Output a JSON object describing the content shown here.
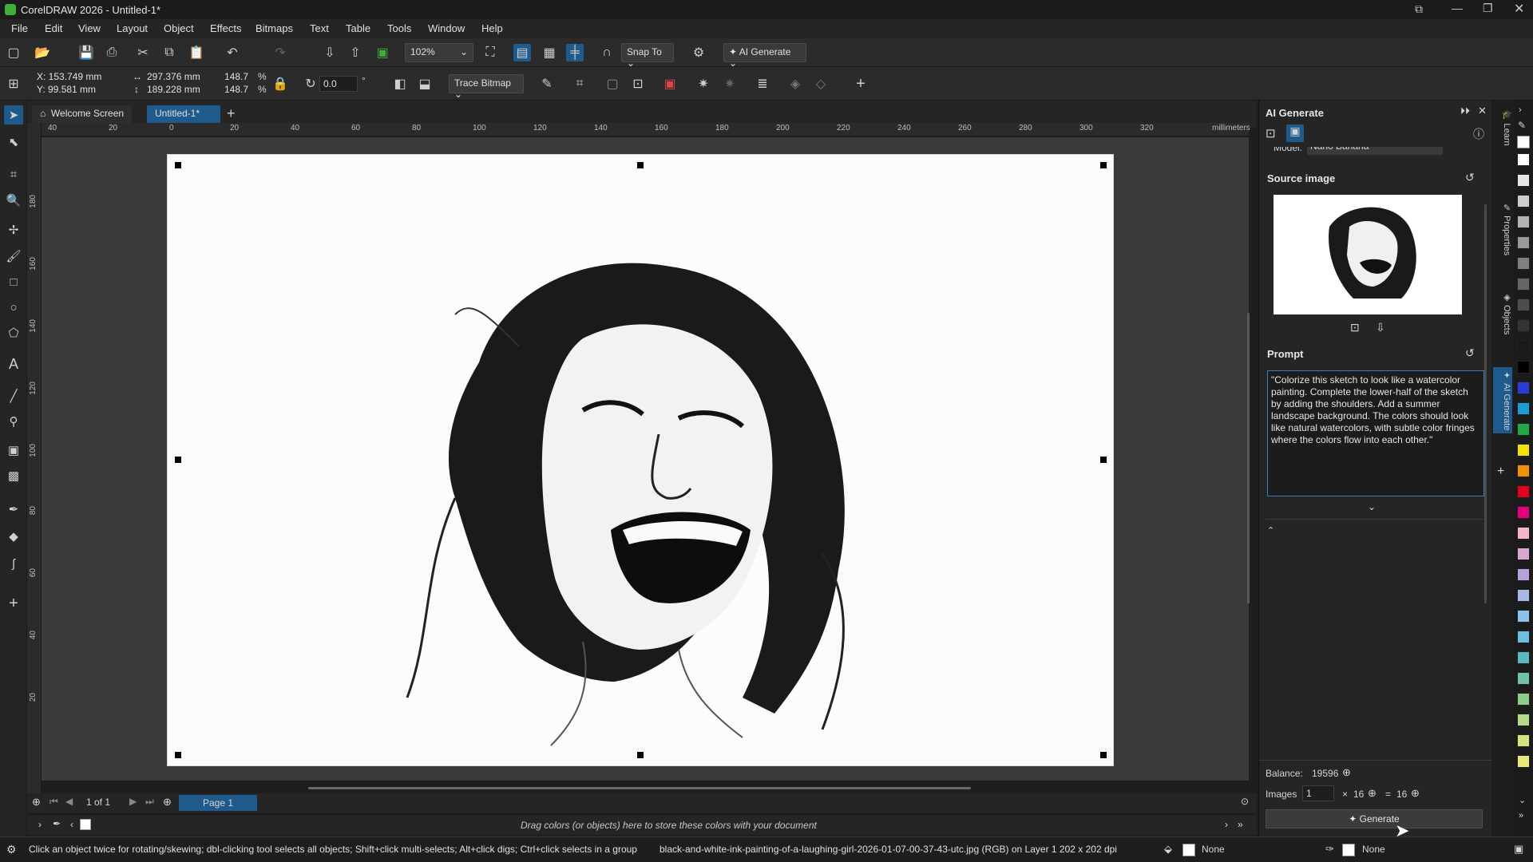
{
  "app": {
    "title": "CorelDRAW 2026 - Untitled-1*"
  },
  "menu": [
    "File",
    "Edit",
    "View",
    "Layout",
    "Object",
    "Effects",
    "Bitmaps",
    "Text",
    "Table",
    "Tools",
    "Window",
    "Help"
  ],
  "toolbar": {
    "zoom": "102%",
    "snap_to": "Snap To",
    "ai_generate": "AI Generate"
  },
  "properties": {
    "x": "X: 153.749 mm",
    "y": "Y: 99.581 mm",
    "width": "297.376 mm",
    "height": "189.228 mm",
    "scale_w": "148.7",
    "scale_h": "148.7",
    "pct": "%",
    "rotation": "0.0",
    "deg": "°",
    "trace_bitmap": "Trace Bitmap"
  },
  "tabs": {
    "welcome": "Welcome Screen",
    "doc": "Untitled-1*"
  },
  "ruler": {
    "unit": "millimeters",
    "h_ticks": [
      "40",
      "20",
      "0",
      "20",
      "40",
      "60",
      "80",
      "100",
      "120",
      "140",
      "160",
      "180",
      "200",
      "220",
      "240",
      "260",
      "280",
      "300",
      "320"
    ],
    "v_ticks": [
      "180",
      "160",
      "140",
      "120",
      "100",
      "80",
      "60",
      "40",
      "20"
    ]
  },
  "pager": {
    "count": "1 of 1",
    "page_tab": "Page 1"
  },
  "palette": {
    "hint": "Drag colors (or objects) here to store these colors with your document"
  },
  "status": {
    "hint": "Click an object twice for rotating/skewing; dbl-clicking tool selects all objects; Shift+click multi-selects; Alt+click digs; Ctrl+click selects in a group",
    "file": "black-and-white-ink-painting-of-a-laughing-girl-2026-01-07-00-37-43-utc.jpg (RGB) on Layer 1  202 x 202 dpi",
    "fill": "None",
    "outline": "None"
  },
  "docker": {
    "title": "AI Generate",
    "model_label": "Model:",
    "model_value": "Nano Banana",
    "source_image": "Source image",
    "prompt_label": "Prompt",
    "prompt_text": "\"Colorize this sketch to look like a watercolor painting. Complete the lower-half of the sketch by adding the shoulders. Add a summer landscape background. The colors should look like natural  watercolors, with subtle color fringes where the colors flow into each other.\"",
    "balance_label": "Balance:",
    "balance_value": "19596",
    "images_label": "Images",
    "images_value": "1",
    "times": "×",
    "per": "16",
    "equals": "=",
    "total": "16",
    "generate": "Generate"
  },
  "docker_tabs": [
    "Learn",
    "Properties",
    "Objects",
    "AI Generate"
  ],
  "colors": {
    "accent": "#1e5a8c",
    "bg": "#252526"
  },
  "palette_swatches": [
    "#ffffff",
    "#e6e6e6",
    "#cccccc",
    "#b3b3b3",
    "#999999",
    "#808080",
    "#666666",
    "#4d4d4d",
    "#333333",
    "#1a1a1a",
    "#000000",
    "#2b3bd6",
    "#1d9bd7",
    "#1fa84a",
    "#f4e500",
    "#f39200",
    "#e3001b",
    "#e5007e",
    "#f6b6c8",
    "#d9a6cf",
    "#b5a2d8",
    "#a7b8e4",
    "#8dc3e8",
    "#6cc0e0",
    "#5bb8c0",
    "#6fc2a3",
    "#8fcc8a",
    "#b4d98a",
    "#d3e57c",
    "#e9ea7a"
  ]
}
